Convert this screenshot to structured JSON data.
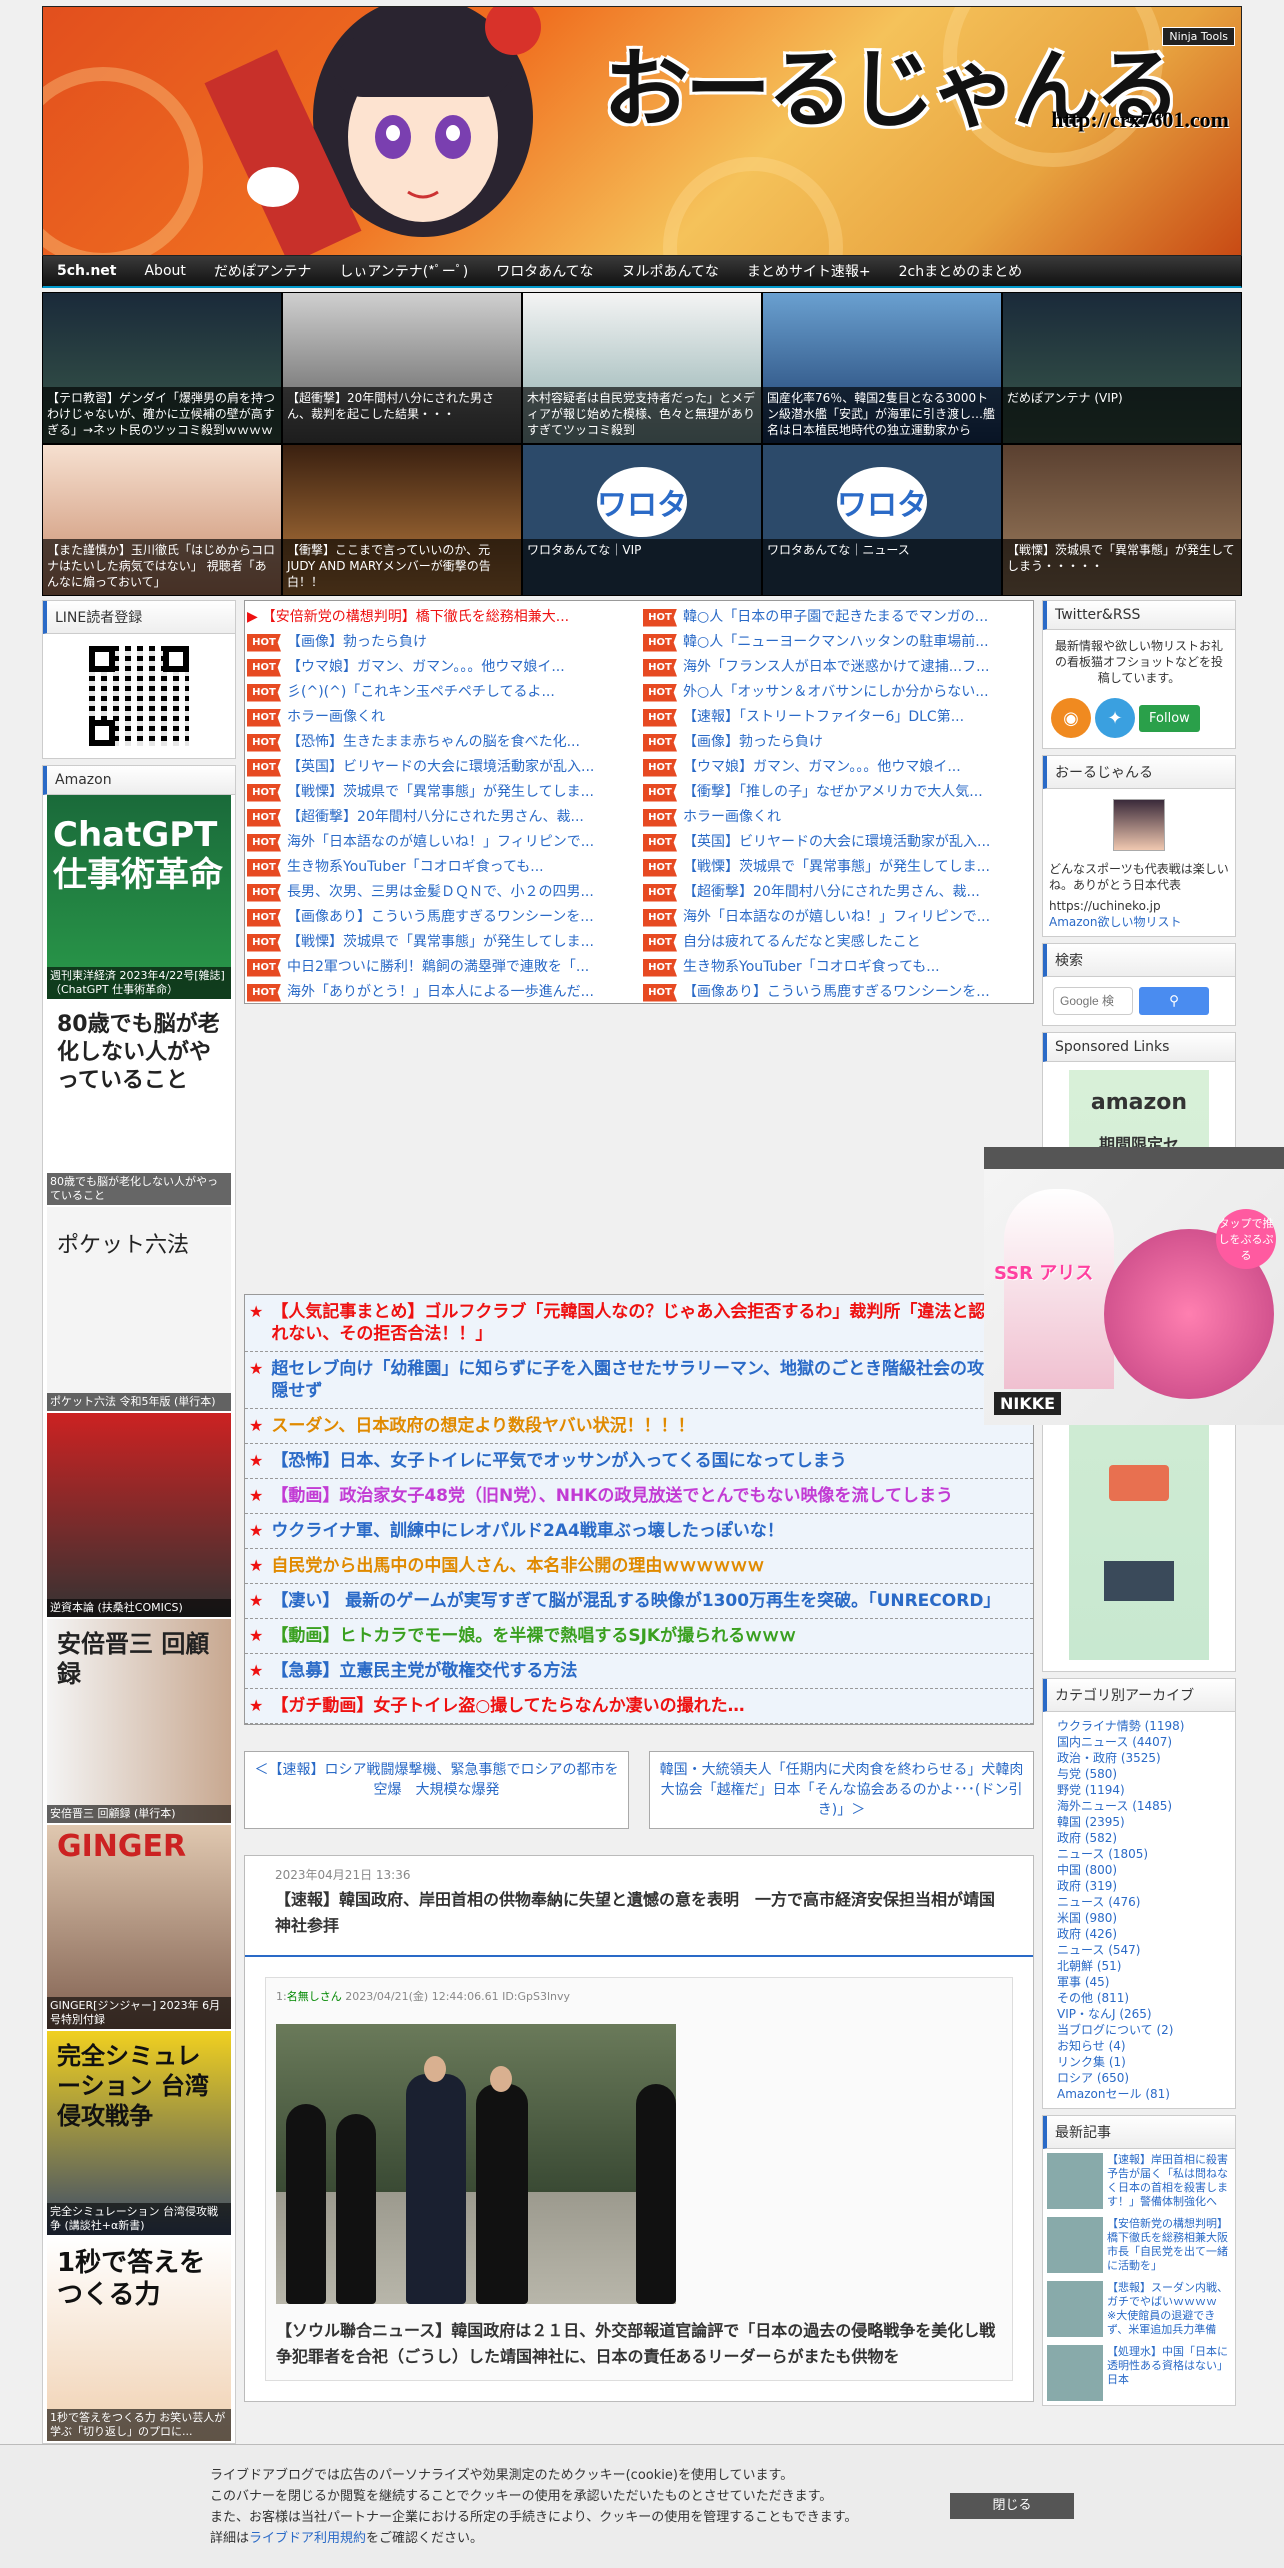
{
  "header": {
    "title": "おーるじゃんる",
    "url": "http://crx7601.com",
    "badge": "Ninja Tools"
  },
  "nav": [
    "5ch.net",
    "About",
    "だめぽアンテナ",
    "しぃアンテナ(*ﾟーﾟ)",
    "ワロタあんてな",
    "ヌルポあんてな",
    "まとめサイト速報+",
    "2chまとめのまとめ"
  ],
  "thumbs": [
    {
      "caption": "【テロ教習】ゲンダイ「爆弾男の肩を持つわけじゃないが、確かに立候補の壁が高すぎる」→ネット民のツッコミ殺到ｗｗｗｗｗ",
      "logo": ""
    },
    {
      "caption": "【超衝撃】20年間村八分にされた男さん、裁判を起こした結果・・・",
      "logo": ""
    },
    {
      "caption": "木村容疑者は自民党支持者だった」とメディアが報じ始めた模様、色々と無理がありすぎてツッコミ殺到",
      "logo": ""
    },
    {
      "caption": "国産化率76％、韓国2隻目となる3000トン級潜水艦「安武」が海軍に引き渡し…艦名は日本植民地時代の独立運動家から",
      "logo": ""
    },
    {
      "caption": "だめぽアンテナ (VIP)",
      "logo": ""
    },
    {
      "caption": "【また謹慎か】玉川徹氏「はじめからコロナはたいした病気ではない」 視聴者「あんなに煽っておいて」",
      "logo": ""
    },
    {
      "caption": "【衝撃】ここまで言っていいのか、元JUDY AND MARYメンバーが衝撃の告白！！",
      "logo": ""
    },
    {
      "caption": "ワロタあんてな｜VIP",
      "logo": "ワロタ"
    },
    {
      "caption": "ワロタあんてな｜ニュース",
      "logo": "ワロタ"
    },
    {
      "caption": "【戦慄】茨城県で「異常事態」が発生してしまう・・・・・",
      "logo": ""
    }
  ],
  "left": {
    "line_title": "LINE読者登録",
    "amazon_title": "Amazon",
    "books": [
      {
        "caption": "週刊東洋経済 2023年4/22号[雑誌]（ChatGPT 仕事術革命）",
        "cover": "ChatGPT 仕事術革命"
      },
      {
        "caption": "80歳でも脳が老化しない人がやっていること",
        "cover": "80歳でも脳が老化しない人がやっていること"
      },
      {
        "caption": "ポケット六法 令和5年版 (単行本)",
        "cover": "ポケット六法"
      },
      {
        "caption": "逆資本論 (扶桑社COMICS)",
        "cover": ""
      },
      {
        "caption": "安倍晋三 回顧録 (単行本)",
        "cover": "安倍晋三 回顧録"
      },
      {
        "caption": "GINGER[ジンジャー] 2023年 6月号特別付録",
        "cover": "GINGER"
      },
      {
        "caption": "完全シミュレーション 台湾侵攻戦争 (講談社+α新書)",
        "cover": "完全シミュレーション 台湾侵攻戦争"
      },
      {
        "caption": "1秒で答えをつくる力 お笑い芸人が学ぶ「切り返し」のプロに...",
        "cover": "1秒で答えをつくる力"
      }
    ]
  },
  "headlines": {
    "left": [
      {
        "hot": false,
        "text": "【安倍新党の構想判明】橋下徹氏を総務相兼大..."
      },
      {
        "hot": true,
        "text": "【画像】勃ったら負け"
      },
      {
        "hot": true,
        "text": "【ウマ娘】ガマン、ガマン。。。他ウマ娘イ..."
      },
      {
        "hot": true,
        "text": "彡(^)(^)「これキン玉ペチペチしてるよ..."
      },
      {
        "hot": true,
        "text": "ホラー画像くれ"
      },
      {
        "hot": true,
        "text": "【恐怖】生きたまま赤ちゃんの脳を食べた化..."
      },
      {
        "hot": true,
        "text": "【英国】ビリヤードの大会に環境活動家が乱入..."
      },
      {
        "hot": true,
        "text": "【戦慄】茨城県で「異常事態」が発生してしま..."
      },
      {
        "hot": true,
        "text": "【超衝撃】20年間村八分にされた男さん、裁..."
      },
      {
        "hot": true,
        "text": "海外「日本語なのが嬉しいね！」フィリピンで..."
      },
      {
        "hot": true,
        "text": "生き物系YouTuber「コオロギ食っても..."
      },
      {
        "hot": true,
        "text": "長男、次男、三男は金髪ＤＱＮで、小２の四男..."
      },
      {
        "hot": true,
        "text": "【画像あり】こういう馬鹿すぎるワンシーンを..."
      },
      {
        "hot": true,
        "text": "【戦慄】茨城県で「異常事態」が発生してしま..."
      },
      {
        "hot": true,
        "text": "中日2軍ついに勝利！鵜飼の満塁弾で連敗を「..."
      },
      {
        "hot": true,
        "text": "海外「ありがとう！」日本人による一歩進んだ..."
      }
    ],
    "right": [
      {
        "hot": true,
        "text": "韓○人「日本の甲子園で起きたまるでマンガの..."
      },
      {
        "hot": true,
        "text": "韓○人「ニューヨークマンハッタンの駐車場前..."
      },
      {
        "hot": true,
        "text": "海外「フランス人が日本で迷惑かけて逮捕...フ..."
      },
      {
        "hot": true,
        "text": "外○人「オッサン＆オバサンにしか分からない..."
      },
      {
        "hot": true,
        "text": "【速報】「ストリートファイター6」DLC第..."
      },
      {
        "hot": true,
        "text": "【画像】勃ったら負け"
      },
      {
        "hot": true,
        "text": "【ウマ娘】ガマン、ガマン。。。他ウマ娘イ..."
      },
      {
        "hot": true,
        "text": "【衝撃】「推しの子」なぜかアメリカで大人気..."
      },
      {
        "hot": true,
        "text": "ホラー画像くれ"
      },
      {
        "hot": true,
        "text": "【英国】ビリヤードの大会に環境活動家が乱入..."
      },
      {
        "hot": true,
        "text": "【戦慄】茨城県で「異常事態」が発生してしま..."
      },
      {
        "hot": true,
        "text": "【超衝撃】20年間村八分にされた男さん、裁..."
      },
      {
        "hot": true,
        "text": "海外「日本語なのが嬉しいね！」フィリピンで..."
      },
      {
        "hot": true,
        "text": "自分は疲れてるんだなと実感したこと"
      },
      {
        "hot": true,
        "text": "生き物系YouTuber「コオロギ食っても..."
      },
      {
        "hot": true,
        "text": "【画像あり】こういう馬鹿すぎるワンシーンを..."
      }
    ]
  },
  "rss": [
    {
      "text": "【人気記事まとめ】ゴルフクラブ「元韓国人なの？じゃあ入会拒否するわ」裁判所「違法と認められない、その拒否合法！！」",
      "color": "#e11"
    },
    {
      "text": "超セレブ向け「幼稚園」に知らずに子を入園させたサラリーマン、地獄のごとき階級社会の攻撃を隠せず",
      "color": "#2a6ac7"
    },
    {
      "text": "スーダン、日本政府の想定より数段ヤバい状況！！！！",
      "color": "#e08a00"
    },
    {
      "text": "【恐怖】日本、女子トイレに平気でオッサンが入ってくる国になってしまう",
      "color": "#2a6ac7"
    },
    {
      "text": "【動画】政治家女子48党（旧N党）、NHKの政見放送でとんでもない映像を流してしまう",
      "color": "#c23bd4"
    },
    {
      "text": "ウクライナ軍、訓練中にレオパルド2A4戦車ぶっ壊したっぽいな！",
      "color": "#2a6ac7"
    },
    {
      "text": "自民党から出馬中の中国人さん、本名非公開の理由ｗｗｗｗｗｗ",
      "color": "#e08a00"
    },
    {
      "text": "【凄い】 最新のゲームが実写すぎて脳が混乱する映像が1300万再生を突破。「UNRECORD」",
      "color": "#2a6ac7"
    },
    {
      "text": "【動画】ヒトカラでモー娘。を半裸で熱唱するSJKが撮られるｗｗｗ",
      "color": "#3aa020"
    },
    {
      "text": "【急募】立憲民主党が敬権交代する方法",
      "color": "#2a6ac7"
    },
    {
      "text": "【ガチ動画】女子トイレ盗○撮してたらなんか凄いの撮れた…",
      "color": "#e11"
    }
  ],
  "prev": "＜【速報】ロシア戦闘爆撃機、緊急事態でロシアの都市を空爆　大規模な爆発",
  "next": "韓国・大統領夫人「任期内に犬肉食を終わらせる」犬韓肉大協会「越権だ」日本「そんな協会あるのかよ･･･(ドン引き)」＞",
  "article": {
    "date": "2023年04月21日 13:36",
    "title": "【速報】韓国政府、岸田首相の供物奉納に失望と遺憾の意を表明　一方で高市経済安保担当相が靖国神社参拝",
    "res_num": "1:",
    "res_name": "名無しさん",
    "res_meta": "2023/04/21(金) 12:44:06.61 ID:GpS3lnvy",
    "body": "【ソウル聯合ニュース】韓国政府は２１日、外交部報道官論評で「日本の過去の侵略戦争を美化し戦争犯罪者を合祀（ごうし）した靖国神社に、日本の責任あるリーダーらがまたも供物を"
  },
  "right": {
    "twitter_title": "Twitter&RSS",
    "twitter_desc": "最新情報や欲しい物リストお礼の看板猫オフショットなどを投稿しています。",
    "follow": "Follow",
    "about_title": "おーるじゃんる",
    "about_desc": "どんなスポーツも代表戦は楽しいね。ありがとう日本代表",
    "about_url": "https://uchineko.jp",
    "about_link": "Amazon欲しい物リスト",
    "search_title": "検索",
    "search_placeholder": "Google 検",
    "sponsored_title": "Sponsored Links",
    "sponsored_text": "amazon",
    "sponsored_sub": "期間限定セ",
    "category_title": "カテゴリ別アーカイブ",
    "categories": [
      "ウクライナ情勢 (1198)",
      "国内ニュース (4407)",
      "政治・政府 (3525)",
      "与党 (580)",
      "野党 (1194)",
      "海外ニュース (1485)",
      "韓国 (2395)",
      "政府 (582)",
      "ニュース (1805)",
      "中国 (800)",
      "政府 (319)",
      "ニュース (476)",
      "米国 (980)",
      "政府 (426)",
      "ニュース (547)",
      "北朝鮮 (51)",
      "軍事 (45)",
      "その他 (811)",
      "VIP・なんJ (265)",
      "当ブログについて (2)",
      "お知らせ (4)",
      "リンク集 (1)",
      "ロシア (650)",
      "Amazonセール (81)"
    ],
    "recent_title": "最新記事",
    "recent": [
      "【速報】岸田首相に殺害予告が届く「私は問ねなく日本の首相を殺害します！」警備体制強化へ",
      "【安倍新党の構想判明】橋下徹氏を総務相兼大阪市長「自民党を出て一緒に活動を」",
      "【悲報】スーダン内戦、ガチでやばいｗｗｗｗ　※大使館員の退避できず、米軍追加兵力準備",
      "【処理水】中国「日本に透明性ある資格はない」日本"
    ]
  },
  "ad": {
    "label": "SSR アリス",
    "badge": "NIKKE",
    "cta": "タップで推しをぷるぷる"
  },
  "cookie": {
    "line1": "ライブドアブログでは広告のパーソナライズや効果測定のためクッキー(cookie)を使用しています。",
    "line2": "このバナーを閉じるか閲覧を継続することでクッキーの使用を承認いただいたものとさせていただきます。",
    "line3": "また、お客様は当社パートナー企業における所定の手続きにより、クッキーの使用を管理することもできます。",
    "line4_pre": "詳細は",
    "line4_link": "ライブドア利用規約",
    "line4_post": "をご確認ください。",
    "close": "閉じる"
  }
}
